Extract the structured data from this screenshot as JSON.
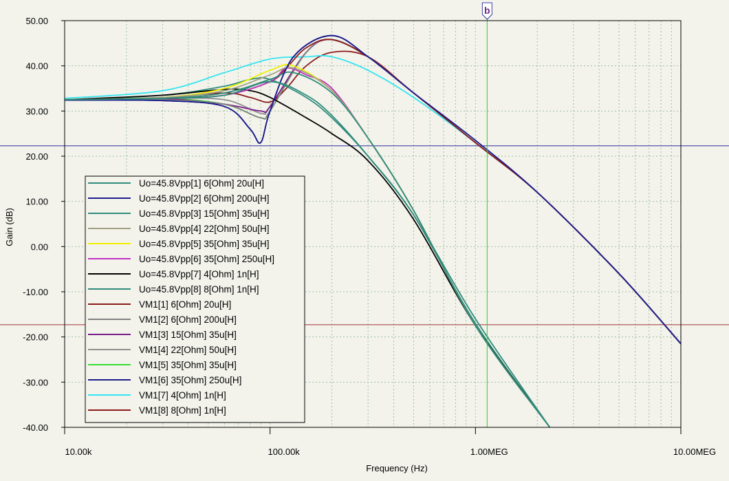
{
  "chart_data": {
    "type": "line",
    "title": "",
    "xlabel": "Frequency (Hz)",
    "ylabel": "Gain (dB)",
    "xscale": "log",
    "xlim": [
      10000,
      10000000
    ],
    "ylim": [
      -40,
      50
    ],
    "grid": true,
    "legend_position": "bottom-left",
    "x_ticks": [
      "10.00k",
      "100.00k",
      "1.00MEG",
      "10.00MEG"
    ],
    "y_ticks": [
      "50.00",
      "40.00",
      "30.00",
      "20.00",
      "10.00",
      "0.00",
      "-10.00",
      "-20.00",
      "-30.00",
      "-40.00"
    ],
    "cursor": {
      "label": "b",
      "x": 1140000,
      "color": "#2ecc2e"
    },
    "hlines": [
      {
        "y": 22.3,
        "color": "#2a2aa0"
      },
      {
        "y": -17.3,
        "color": "#a03030"
      }
    ],
    "series": [
      {
        "name": "Uo=45.8Vpp[1]  6[Ohm] 20u[H]",
        "color": "#2e8b7a",
        "x": [
          10000,
          30000,
          60000,
          100000,
          150000,
          200000,
          300000,
          500000,
          1000000,
          2300000
        ],
        "y": [
          32.5,
          32.8,
          33.5,
          36.5,
          33.5,
          29,
          20,
          7,
          -16,
          -40
        ]
      },
      {
        "name": "Uo=45.8Vpp[2]  6[Ohm] 200u[H]",
        "color": "#1c1c8c",
        "x": [
          10000,
          30000,
          60000,
          80000,
          90000,
          100000,
          130000,
          200000,
          300000,
          500000,
          1000000,
          2000000,
          5000000,
          10000000
        ],
        "y": [
          32.4,
          32.3,
          31,
          26,
          23,
          30,
          42,
          46.7,
          42,
          34,
          23.5,
          12,
          -6,
          -21.5
        ]
      },
      {
        "name": "Uo=45.8Vpp[3]  15[Ohm] 35u[H]",
        "color": "#2e8b7a",
        "x": [
          10000,
          30000,
          60000,
          100000,
          130000,
          200000,
          300000,
          500000,
          1000000,
          2300000
        ],
        "y": [
          32.5,
          32.8,
          34,
          37,
          38.5,
          34,
          24,
          8,
          -17.5,
          -40
        ]
      },
      {
        "name": "Uo=45.8Vpp[4]  22[Ohm] 50u[H]",
        "color": "#a0a080",
        "x": [
          10000,
          30000,
          60000,
          100000,
          130000,
          200000,
          300000,
          500000,
          1000000,
          2300000
        ],
        "y": [
          32.5,
          33,
          34.5,
          38,
          39.5,
          34.5,
          24,
          8,
          -17.5,
          -40
        ]
      },
      {
        "name": "Uo=45.8Vpp[5]  35[Ohm] 35u[H]",
        "color": "#f0f000",
        "x": [
          10000,
          30000,
          60000,
          100000,
          130000,
          200000,
          300000,
          500000,
          1000000,
          2300000
        ],
        "y": [
          32.5,
          33,
          35,
          39,
          40,
          34.5,
          24,
          8,
          -17.5,
          -40
        ]
      },
      {
        "name": "Uo=45.8Vpp[6]  35[Ohm] 250u[H]",
        "color": "#c030c0",
        "x": [
          10000,
          30000,
          60000,
          100000,
          120000,
          150000,
          200000,
          300000,
          500000,
          1000000,
          2300000
        ],
        "y": [
          32.5,
          32.8,
          33.5,
          36.5,
          39.5,
          38,
          35,
          24,
          8,
          -17.5,
          -40
        ]
      },
      {
        "name": "Uo=45.8Vpp[7]  4[Ohm] 1n[H]",
        "color": "#000000",
        "x": [
          10000,
          30000,
          60000,
          80000,
          100000,
          150000,
          200000,
          300000,
          500000,
          1000000,
          2300000
        ],
        "y": [
          32.5,
          33.5,
          34.8,
          34.5,
          33,
          28.5,
          25,
          19,
          6,
          -17.5,
          -40
        ]
      },
      {
        "name": "Uo=45.8Vpp[8]  8[Ohm] 1n[H]",
        "color": "#2e8b7a",
        "x": [
          10000,
          30000,
          60000,
          80000,
          100000,
          150000,
          200000,
          300000,
          500000,
          1000000,
          2300000
        ],
        "y": [
          32.5,
          33.5,
          35.5,
          37,
          37,
          33,
          28.5,
          20,
          7,
          -17,
          -40
        ]
      },
      {
        "name": "VM1[1]  6[Ohm] 20u[H]",
        "color": "#8b1a1a",
        "x": [
          10000,
          30000,
          60000,
          100000,
          120000,
          150000,
          200000,
          300000,
          500000,
          1000000,
          2000000,
          5000000,
          10000000
        ],
        "y": [
          32.5,
          32.8,
          33.5,
          36.5,
          39.5,
          44,
          45.8,
          42,
          34,
          23,
          12,
          -6,
          -21.5
        ]
      },
      {
        "name": "VM1[2]  6[Ohm] 200u[H]",
        "color": "#808080",
        "x": [
          10000,
          30000,
          60000,
          90000,
          100000,
          150000,
          200000,
          300000,
          500000,
          1000000,
          2000000,
          5000000,
          10000000
        ],
        "y": [
          32.5,
          32.5,
          31.5,
          28.5,
          30,
          43,
          45.8,
          42,
          34,
          23,
          12,
          -6,
          -21.5
        ]
      },
      {
        "name": "VM1[3]  15[Ohm] 35u[H]",
        "color": "#7a1a8a",
        "x": [
          10000,
          30000,
          60000,
          90000,
          100000,
          150000,
          200000,
          300000,
          500000,
          1000000,
          2000000,
          5000000,
          10000000
        ],
        "y": [
          32.5,
          32.7,
          31.5,
          30,
          31,
          43,
          45.8,
          42,
          34,
          23,
          12,
          -6,
          -21.5
        ]
      },
      {
        "name": "VM1[4]  22[Ohm] 50u[H]",
        "color": "#909090",
        "x": [
          10000,
          30000,
          60000,
          90000,
          100000,
          150000,
          200000,
          300000,
          500000,
          1000000,
          2000000,
          5000000,
          10000000
        ],
        "y": [
          32.5,
          32.8,
          32.5,
          29.5,
          31,
          43,
          45.8,
          42,
          34,
          23,
          12,
          -6,
          -21.5
        ]
      },
      {
        "name": "VM1[5]  35[Ohm] 35u[H]",
        "color": "#33dd33",
        "x": [
          10000,
          30000,
          60000,
          90000,
          100000,
          150000,
          200000,
          300000,
          500000,
          1000000,
          2000000,
          5000000,
          10000000
        ],
        "y": [
          32.5,
          32.8,
          31.5,
          28.5,
          30,
          43,
          45.8,
          42,
          34,
          23,
          12,
          -6,
          -21.5
        ]
      },
      {
        "name": "VM1[6]  35[Ohm] 250u[H]",
        "color": "#1c1c8c",
        "x": [
          10000,
          30000,
          60000,
          80000,
          90000,
          100000,
          130000,
          200000,
          300000,
          500000,
          1000000,
          2000000,
          5000000,
          10000000
        ],
        "y": [
          32.4,
          32.3,
          31,
          26,
          23,
          30,
          42,
          46.7,
          42,
          34,
          23,
          12,
          -6,
          -21.5
        ]
      },
      {
        "name": "VM1[7]  4[Ohm] 1n[H]",
        "color": "#33e5f0",
        "x": [
          10000,
          30000,
          60000,
          100000,
          150000,
          200000,
          300000,
          500000,
          1000000,
          2000000,
          5000000,
          10000000
        ],
        "y": [
          32.8,
          34.5,
          38.5,
          41.5,
          42,
          42,
          39,
          33,
          23,
          12,
          -6,
          -21.5
        ]
      },
      {
        "name": "VM1[8]  8[Ohm] 1n[H]",
        "color": "#8b1a1a",
        "x": [
          10000,
          30000,
          60000,
          80000,
          100000,
          120000,
          150000,
          200000,
          300000,
          500000,
          1000000,
          2000000,
          5000000,
          10000000
        ],
        "y": [
          32.5,
          33,
          34,
          33,
          32,
          35,
          40,
          43,
          42,
          34,
          23,
          12,
          -6,
          -21.5
        ]
      }
    ]
  }
}
